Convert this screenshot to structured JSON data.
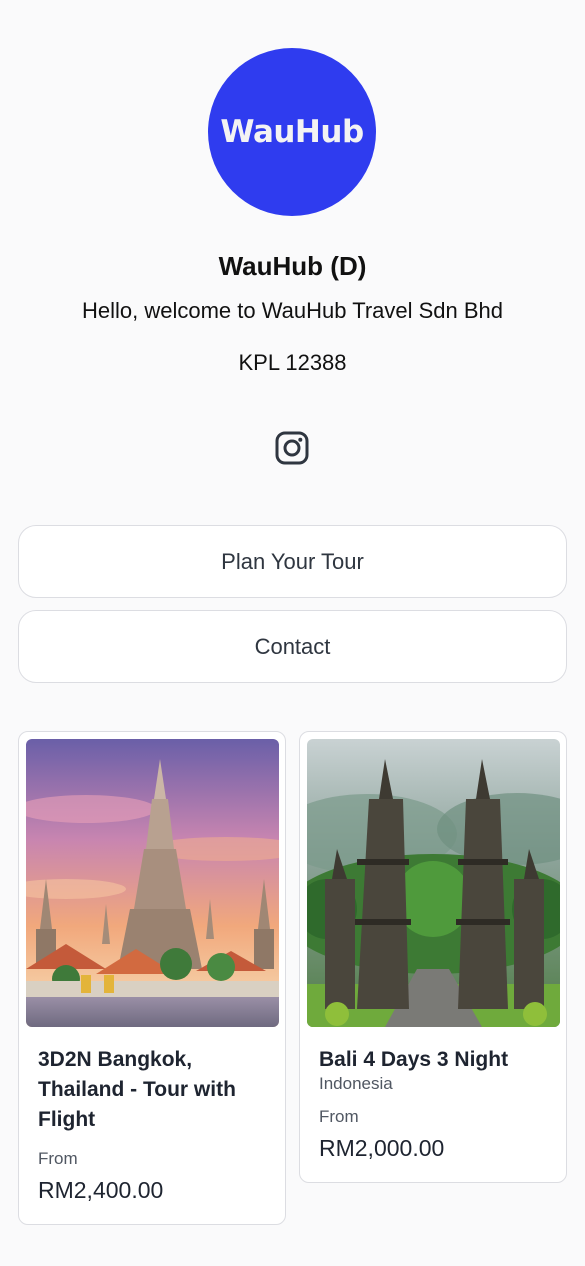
{
  "profile": {
    "logo_text": "WauHub",
    "name": "WauHub (D)",
    "bio": "Hello, welcome to WauHub Travel Sdn Bhd",
    "license": "KPL 12388",
    "brand_color": "#2f3cef"
  },
  "social": {
    "icon": "instagram-icon"
  },
  "links": [
    {
      "label": "Plan Your Tour"
    },
    {
      "label": "Contact"
    }
  ],
  "products": [
    {
      "title": "3D2N Bangkok, Thailand - Tour with Flight",
      "subtitle": "",
      "from_label": "From",
      "price": "RM2,400.00",
      "image": "wat-arun-temple-sunset-photo"
    },
    {
      "title": "Bali 4 Days 3 Night",
      "subtitle": "Indonesia",
      "from_label": "From",
      "price": "RM2,000.00",
      "image": "bali-temple-gate-photo"
    }
  ]
}
